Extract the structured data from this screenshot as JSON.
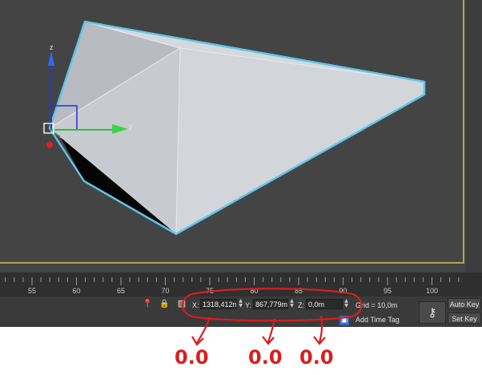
{
  "viewport": {
    "axis_z_label": "z",
    "axis_y_label": "y"
  },
  "timeline": {
    "ticks": [
      "55",
      "60",
      "65",
      "70",
      "75",
      "80",
      "85",
      "90",
      "95",
      "100"
    ]
  },
  "statusbar": {
    "x_label": "X:",
    "x_value": "1318,412m",
    "y_label": "Y:",
    "y_value": "867,779m",
    "z_label": "Z:",
    "z_value": "0,0m",
    "grid_text": "Grid = 10,0m",
    "add_time_tag": "Add Time Tag",
    "auto_key": "Auto Key",
    "set_key": "Set Key"
  },
  "annotations": {
    "x_new": "0.0",
    "y_new": "0.0",
    "z_new": "0.0",
    "color": "#d81e1e"
  },
  "colors": {
    "viewport_bg": "#444444",
    "selection_outline": "#5ec4e8",
    "viewport_border": "#b8a254"
  }
}
